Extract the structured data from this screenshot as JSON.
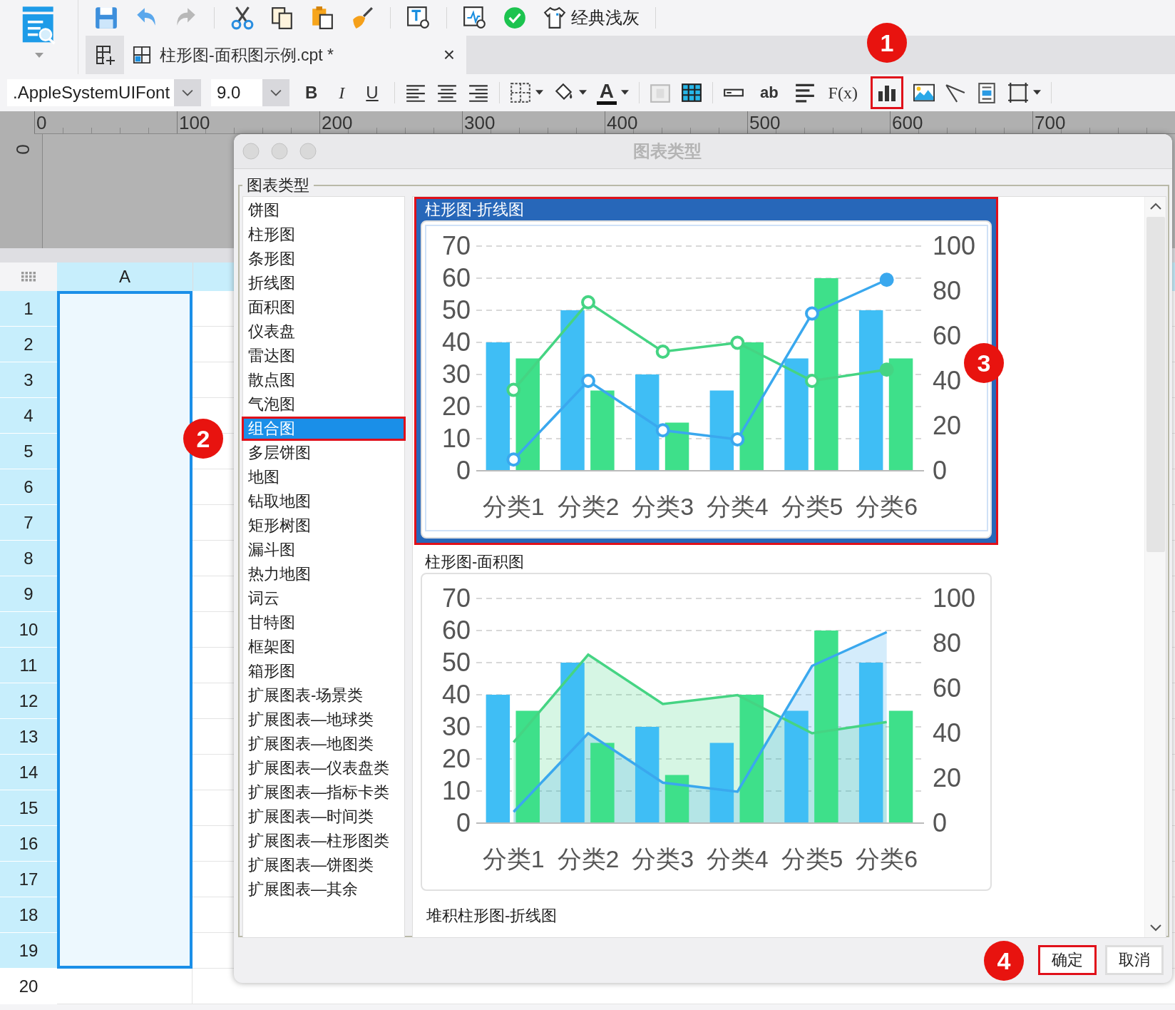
{
  "toolbar": {
    "theme_label": "经典浅灰"
  },
  "document_tab": {
    "title": "柱形图-面积图示例.cpt *",
    "close": "×"
  },
  "format_toolbar": {
    "font_field": ".AppleSystemUIFont",
    "size_field": "9.0",
    "bold": "B",
    "italic": "I",
    "underline": "U",
    "font_color": "A",
    "text_tool": "ab",
    "formula": "F(x)",
    "chart_button": {
      "highlighted": true,
      "callout": "1"
    }
  },
  "ruler": {
    "horizontal": [
      "0",
      "100",
      "200",
      "300",
      "400",
      "500",
      "600",
      "700"
    ],
    "vertical": "0"
  },
  "sheet": {
    "columns": [
      "A"
    ],
    "rows": [
      {
        "label": "1",
        "selected": true
      },
      {
        "label": "2",
        "selected": true
      },
      {
        "label": "3",
        "selected": true
      },
      {
        "label": "4",
        "selected": true
      },
      {
        "label": "5",
        "selected": true
      },
      {
        "label": "6",
        "selected": true
      },
      {
        "label": "7",
        "selected": true
      },
      {
        "label": "8",
        "selected": true
      },
      {
        "label": "9",
        "selected": true
      },
      {
        "label": "10",
        "selected": true
      },
      {
        "label": "11",
        "selected": true
      },
      {
        "label": "12",
        "selected": true
      },
      {
        "label": "13",
        "selected": true
      },
      {
        "label": "14",
        "selected": true
      },
      {
        "label": "15",
        "selected": true
      },
      {
        "label": "16",
        "selected": true
      },
      {
        "label": "17",
        "selected": true
      },
      {
        "label": "18",
        "selected": true
      },
      {
        "label": "19",
        "selected": true
      },
      {
        "label": "20",
        "selected": false
      }
    ]
  },
  "dialog": {
    "title": "图表类型",
    "group_label": "图表类型",
    "chart_types": [
      {
        "label": "饼图",
        "selected": false,
        "highlighted": false
      },
      {
        "label": "柱形图",
        "selected": false,
        "highlighted": false
      },
      {
        "label": "条形图",
        "selected": false,
        "highlighted": false
      },
      {
        "label": "折线图",
        "selected": false,
        "highlighted": false
      },
      {
        "label": "面积图",
        "selected": false,
        "highlighted": false
      },
      {
        "label": "仪表盘",
        "selected": false,
        "highlighted": false
      },
      {
        "label": "雷达图",
        "selected": false,
        "highlighted": false
      },
      {
        "label": "散点图",
        "selected": false,
        "highlighted": false
      },
      {
        "label": "气泡图",
        "selected": false,
        "highlighted": false
      },
      {
        "label": "组合图",
        "selected": true,
        "highlighted": true,
        "callout": "2"
      },
      {
        "label": "多层饼图",
        "selected": false,
        "highlighted": false
      },
      {
        "label": "地图",
        "selected": false,
        "highlighted": false
      },
      {
        "label": "钻取地图",
        "selected": false,
        "highlighted": false
      },
      {
        "label": "矩形树图",
        "selected": false,
        "highlighted": false
      },
      {
        "label": "漏斗图",
        "selected": false,
        "highlighted": false
      },
      {
        "label": "热力地图",
        "selected": false,
        "highlighted": false
      },
      {
        "label": "词云",
        "selected": false,
        "highlighted": false
      },
      {
        "label": "甘特图",
        "selected": false,
        "highlighted": false
      },
      {
        "label": "框架图",
        "selected": false,
        "highlighted": false
      },
      {
        "label": "箱形图",
        "selected": false,
        "highlighted": false
      },
      {
        "label": "扩展图表-场景类",
        "selected": false,
        "highlighted": false
      },
      {
        "label": "扩展图表—地球类",
        "selected": false,
        "highlighted": false
      },
      {
        "label": "扩展图表—地图类",
        "selected": false,
        "highlighted": false
      },
      {
        "label": "扩展图表—仪表盘类",
        "selected": false,
        "highlighted": false
      },
      {
        "label": "扩展图表—指标卡类",
        "selected": false,
        "highlighted": false
      },
      {
        "label": "扩展图表—时间类",
        "selected": false,
        "highlighted": false
      },
      {
        "label": "扩展图表—柱形图类",
        "selected": false,
        "highlighted": false
      },
      {
        "label": "扩展图表—饼图类",
        "selected": false,
        "highlighted": false
      },
      {
        "label": "扩展图表—其余",
        "selected": false,
        "highlighted": false
      }
    ],
    "previews": [
      {
        "title": "柱形图-折线图",
        "selected": true,
        "highlighted": true,
        "callout": "3",
        "chart_data": {
          "type": "bar",
          "grid": true,
          "categories": [
            "分类1",
            "分类2",
            "分类3",
            "分类4",
            "分类5",
            "分类6"
          ],
          "ylim": [
            0,
            70
          ],
          "yticks": [
            0,
            10,
            20,
            30,
            40,
            50,
            60,
            70
          ],
          "y2lim": [
            0,
            100
          ],
          "y2ticks": [
            0,
            20,
            40,
            60,
            80,
            100
          ],
          "series": [
            {
              "color": "#3fbef5",
              "values": [
                40,
                50,
                30,
                25,
                35,
                50
              ]
            },
            {
              "color": "#3ee08a",
              "values": [
                35,
                25,
                15,
                40,
                60,
                35
              ]
            },
            {
              "type": "line",
              "axis": "y2",
              "marker": "circle",
              "color": "#45d483",
              "values": [
                36,
                75,
                53,
                57,
                40,
                45
              ]
            },
            {
              "type": "line",
              "axis": "y2",
              "marker": "circle",
              "color": "#3aa8ee",
              "values": [
                5,
                40,
                18,
                14,
                70,
                85
              ]
            }
          ]
        }
      },
      {
        "title": "柱形图-面积图",
        "selected": false,
        "highlighted": false,
        "chart_data": {
          "type": "bar",
          "grid": true,
          "categories": [
            "分类1",
            "分类2",
            "分类3",
            "分类4",
            "分类5",
            "分类6"
          ],
          "ylim": [
            0,
            70
          ],
          "yticks": [
            0,
            10,
            20,
            30,
            40,
            50,
            60,
            70
          ],
          "y2lim": [
            0,
            100
          ],
          "y2ticks": [
            0,
            20,
            40,
            60,
            80,
            100
          ],
          "series": [
            {
              "color": "#3fbef5",
              "values": [
                40,
                50,
                30,
                25,
                35,
                50
              ]
            },
            {
              "color": "#3ee08a",
              "values": [
                35,
                25,
                15,
                40,
                60,
                35
              ]
            },
            {
              "type": "area",
              "axis": "y2",
              "color": "#45d483",
              "values": [
                36,
                75,
                53,
                57,
                40,
                45
              ]
            },
            {
              "type": "area",
              "axis": "y2",
              "color": "#3aa8ee",
              "values": [
                5,
                40,
                18,
                14,
                70,
                85
              ]
            }
          ]
        }
      },
      {
        "title": "堆积柱形图-折线图",
        "selected": false,
        "highlighted": false
      }
    ],
    "buttons": [
      {
        "label": "确定",
        "highlighted": true,
        "callout": "4"
      },
      {
        "label": "取消",
        "highlighted": false
      }
    ]
  }
}
